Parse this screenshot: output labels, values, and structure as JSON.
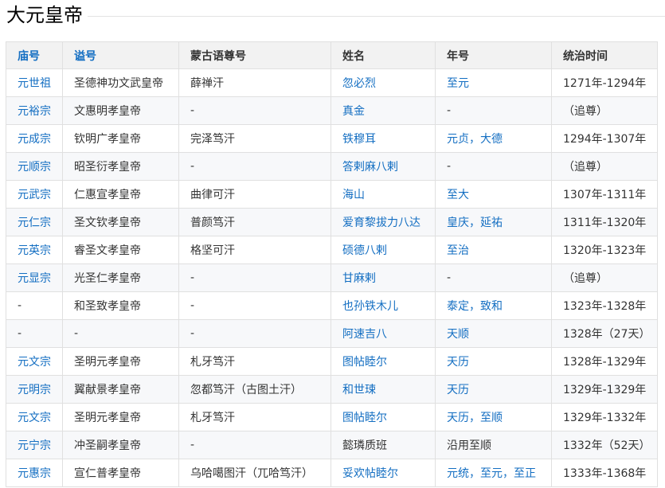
{
  "title": "大元皇帝",
  "headers": [
    "庙号",
    "谥号",
    "蒙古语尊号",
    "姓名",
    "年号",
    "统治时间"
  ],
  "link_color": "#136ec2",
  "rows": [
    [
      "元世祖",
      "圣德神功文武皇帝",
      "薛禅汗",
      "忽必烈",
      "至元",
      "1271年-1294年"
    ],
    [
      "元裕宗",
      "文惠明孝皇帝",
      "-",
      "真金",
      "-",
      "（追尊）"
    ],
    [
      "元成宗",
      "钦明广孝皇帝",
      "完泽笃汗",
      "铁穆耳",
      "元贞，大德",
      "1294年-1307年"
    ],
    [
      "元顺宗",
      "昭圣衍孝皇帝",
      "-",
      "答剌麻八剌",
      "-",
      "（追尊）"
    ],
    [
      "元武宗",
      "仁惠宣孝皇帝",
      "曲律可汗",
      "海山",
      "至大",
      "1307年-1311年"
    ],
    [
      "元仁宗",
      "圣文钦孝皇帝",
      "普颜笃汗",
      "爱育黎拔力八达",
      "皇庆，延祐",
      "1311年-1320年"
    ],
    [
      "元英宗",
      "睿圣文孝皇帝",
      "格坚可汗",
      "硕德八剌",
      "至治",
      "1320年-1323年"
    ],
    [
      "元显宗",
      "光圣仁孝皇帝",
      "-",
      "甘麻剌",
      "-",
      "（追尊）"
    ],
    [
      "-",
      "和圣致孝皇帝",
      "-",
      "也孙铁木儿",
      "泰定，致和",
      "1323年-1328年"
    ],
    [
      "-",
      "-",
      "-",
      "阿速吉八",
      "天顺",
      "1328年（27天）"
    ],
    [
      "元文宗",
      "圣明元孝皇帝",
      "札牙笃汗",
      "图帖睦尔",
      "天历",
      "1328年-1329年"
    ],
    [
      "元明宗",
      "翼献景孝皇帝",
      "忽都笃汗（古图土汗）",
      "和世㻋",
      "天历",
      "1329年-1329年"
    ],
    [
      "元文宗",
      "圣明元孝皇帝",
      "札牙笃汗",
      "图帖睦尔",
      "天历，至顺",
      "1329年-1332年"
    ],
    [
      "元宁宗",
      "冲圣嗣孝皇帝",
      "-",
      "懿璘质班",
      "沿用至顺",
      "1332年（52天）"
    ],
    [
      "元惠宗",
      "宣仁普孝皇帝",
      "乌哈噶图汗（兀哈笃汗）",
      "妥欢帖睦尔",
      "元统，至元，至正",
      "1333年-1368年"
    ]
  ]
}
